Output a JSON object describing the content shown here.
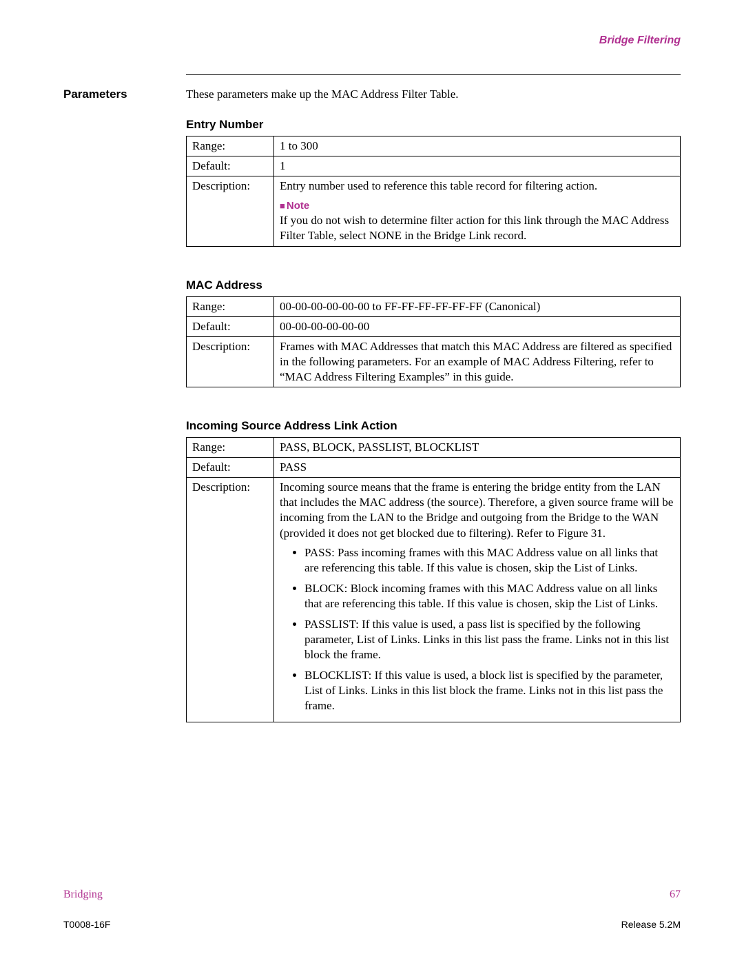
{
  "header": {
    "title": "Bridge Filtering"
  },
  "sideLabel": "Parameters",
  "intro": "These parameters make up the MAC Address Filter Table.",
  "sections": [
    {
      "title": "Entry Number",
      "range": "1 to 300",
      "default": "1",
      "description": "Entry number used to reference this table record for filtering action.",
      "noteLabel": "Note",
      "noteBody": "If you do not wish to determine filter action for this link through the MAC Address Filter Table, select NONE in the Bridge Link record."
    },
    {
      "title": "MAC Address",
      "range": "00-00-00-00-00-00 to FF-FF-FF-FF-FF-FF (Canonical)",
      "default": "00-00-00-00-00-00",
      "description": "Frames with MAC Addresses that match this MAC Address are filtered as specified in the following parameters. For an example of MAC Address Filtering, refer to “MAC Address Filtering Examples” in this guide."
    },
    {
      "title": "Incoming Source Address Link Action",
      "range": "PASS, BLOCK, PASSLIST, BLOCKLIST",
      "default": "PASS",
      "description": "Incoming source means that the frame is entering the bridge entity from the LAN that includes the MAC address (the source). Therefore, a given source frame will be incoming from the LAN to the Bridge and outgoing from the Bridge to the WAN (provided it does not get blocked due to filtering). Refer to Figure 31.",
      "bullets": [
        "PASS: Pass incoming frames with this MAC Address value on all links that are referencing this table. If this value is chosen, skip the List of Links.",
        "BLOCK: Block incoming frames with this MAC Address value on all links that are referencing this table. If this value is chosen, skip the List of Links.",
        "PASSLIST: If this value is used, a pass list is specified by the following parameter, List of Links. Links in this list pass the frame. Links not in this list block the frame.",
        "BLOCKLIST: If this value is used, a block list is specified by the parameter, List of Links. Links in this list block the frame. Links not in this list pass the frame."
      ]
    }
  ],
  "labels": {
    "range": "Range:",
    "default": "Default:",
    "description": "Description:"
  },
  "footer1": {
    "left": "Bridging",
    "right": "67"
  },
  "footer2": {
    "left": "T0008-16F",
    "right": "Release 5.2M"
  }
}
